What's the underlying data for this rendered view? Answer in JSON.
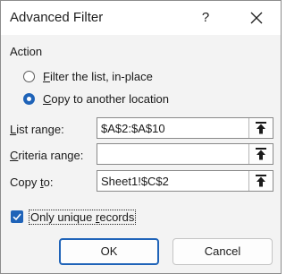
{
  "window": {
    "title": "Advanced Filter",
    "help_label": "?"
  },
  "action": {
    "label": "Action",
    "options": [
      {
        "label": "Filter the list, in-place",
        "mnemonic": "F",
        "rest": "ilter the list, in-place",
        "selected": false
      },
      {
        "label": "Copy to another location",
        "mnemonic": "C",
        "rest": "opy to another location",
        "selected": true
      }
    ]
  },
  "fields": {
    "list_range": {
      "label": "List range:",
      "label_mn": "L",
      "label_rest": "ist range:",
      "value": "$A$2:$A$10"
    },
    "criteria_range": {
      "label": "Criteria range:",
      "label_mn": "C",
      "label_rest": "riteria range:",
      "value": ""
    },
    "copy_to": {
      "label": "Copy to:",
      "label_pre": "Copy ",
      "label_mn": "t",
      "label_rest": "o:",
      "value": "Sheet1!$C$2"
    }
  },
  "unique": {
    "label": "Only unique records",
    "label_pre": "Only unique ",
    "label_mn": "r",
    "label_rest": "ecords",
    "checked": true
  },
  "buttons": {
    "ok": "OK",
    "cancel": "Cancel"
  },
  "colors": {
    "accent": "#1f63b8",
    "dialog_bg": "#f3f3f3",
    "titlebar_bg": "#ffffff"
  }
}
